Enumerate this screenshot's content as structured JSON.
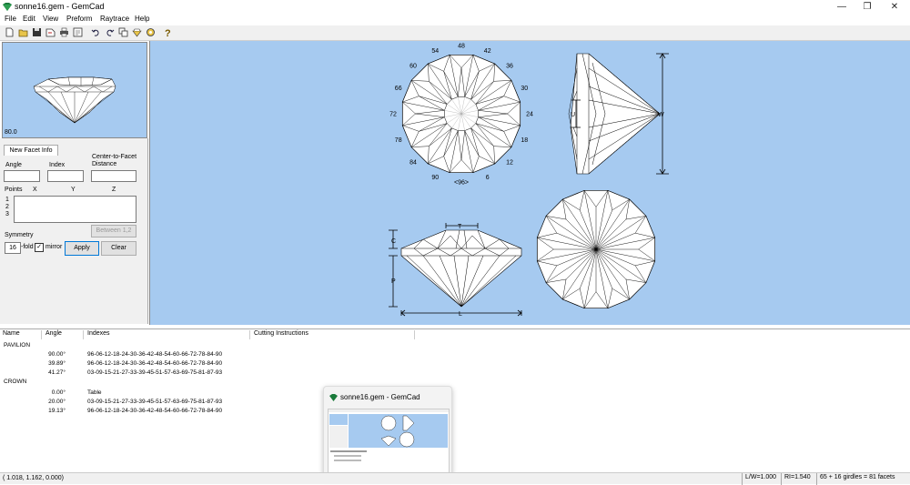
{
  "window": {
    "title": "sonne16.gem - GemCad",
    "minimize": "—",
    "maximize": "❐",
    "close": "✕"
  },
  "menu": [
    "File",
    "Edit",
    "View",
    "Preform",
    "Raytrace",
    "Help"
  ],
  "toolbar": [
    "new-file-icon",
    "open-folder-icon",
    "save-icon",
    "export-icon",
    "print-icon",
    "print-preview-icon",
    "undo-icon",
    "redo-icon",
    "copy-icon",
    "preform-icon",
    "raytrace-icon",
    "help-icon"
  ],
  "preview": {
    "zoom": "80.0"
  },
  "facet_info": {
    "tab": "New Facet Info",
    "angle_label": "Angle",
    "index_label": "Index",
    "distance_label_1": "Center-to-Facet",
    "distance_label_2": "Distance",
    "points_label": "Points",
    "x_label": "X",
    "y_label": "Y",
    "z_label": "Z",
    "p1": "1",
    "p2": "2",
    "p3": "3",
    "between_label": "Between 1,2",
    "symmetry_label": "Symmetry",
    "symmetry_value": "16",
    "fold_label": "-fold",
    "mirror_label": "mirror",
    "apply_label": "Apply",
    "clear_label": "Clear"
  },
  "top_view": {
    "index_labels": [
      "48",
      "42",
      "36",
      "30",
      "24",
      "18",
      "12",
      "6",
      "<96>",
      "90",
      "84",
      "78",
      "72",
      "66",
      "60",
      "54"
    ]
  },
  "dimension_labels": {
    "w": "W",
    "u": "U",
    "t": "T",
    "c": "C",
    "p": "P",
    "l": "L"
  },
  "list": {
    "headers": [
      "Name",
      "Angle",
      "Indexes",
      "Cutting Instructions"
    ],
    "rows": [
      {
        "name": "PAVILION",
        "angle": "",
        "indexes": ""
      },
      {
        "name": "",
        "angle": "90.00°",
        "indexes": "96-06-12-18-24-30-36-42-48-54-60-66-72-78-84-90"
      },
      {
        "name": "",
        "angle": "39.89°",
        "indexes": "96-06-12-18-24-30-36-42-48-54-60-66-72-78-84-90"
      },
      {
        "name": "",
        "angle": "41.27°",
        "indexes": "03-09-15-21-27-33-39-45-51-57-63-69-75-81-87-93"
      },
      {
        "name": "CROWN",
        "angle": "",
        "indexes": ""
      },
      {
        "name": "",
        "angle": "0.00°",
        "indexes": "Table"
      },
      {
        "name": "",
        "angle": "20.00°",
        "indexes": "03-09-15-21-27-33-39-45-51-57-63-69-75-81-87-93"
      },
      {
        "name": "",
        "angle": "19.13°",
        "indexes": "96-06-12-18-24-30-36-42-48-54-60-66-72-78-84-90"
      }
    ]
  },
  "status": {
    "coords": "( 1.018, 1.162, 0.000)",
    "lw": "L/W=1.000",
    "ri": "RI=1.540",
    "facets": "65 + 16 girdles = 81 facets"
  },
  "taskbar_thumb": {
    "title": "sonne16.gem - GemCad"
  },
  "colors": {
    "view_bg": "#a6caf0",
    "facet_fill": "#ffffff",
    "line": "#000000"
  }
}
